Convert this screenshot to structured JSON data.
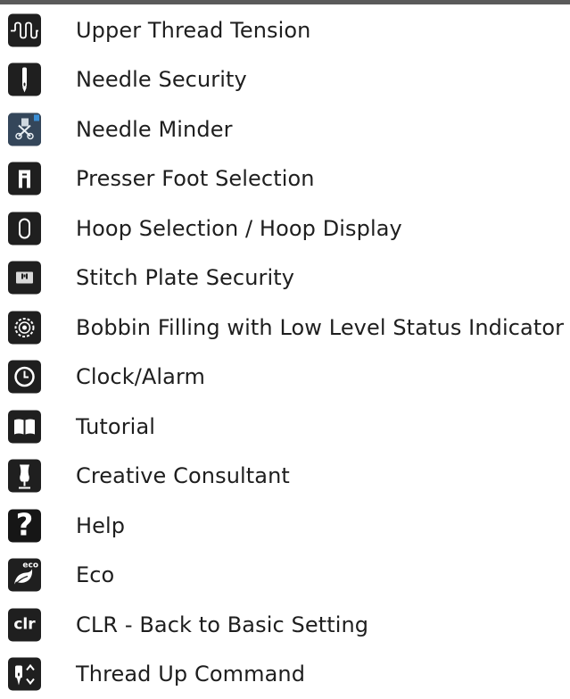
{
  "items": [
    {
      "icon": "thread-tension-icon",
      "label": "Upper Thread Tension"
    },
    {
      "icon": "needle-icon",
      "label": "Needle Security"
    },
    {
      "icon": "needle-minder-icon",
      "label": "Needle Minder"
    },
    {
      "icon": "presser-foot-icon",
      "label": "Presser Foot Selection"
    },
    {
      "icon": "hoop-icon",
      "label": "Hoop Selection / Hoop Display"
    },
    {
      "icon": "stitch-plate-icon",
      "label": "Stitch Plate Security"
    },
    {
      "icon": "bobbin-icon",
      "label": "Bobbin Filling with Low Level Status Indicator"
    },
    {
      "icon": "clock-icon",
      "label": "Clock/Alarm"
    },
    {
      "icon": "book-icon",
      "label": "Tutorial"
    },
    {
      "icon": "dress-form-icon",
      "label": "Creative Consultant"
    },
    {
      "icon": "help-icon",
      "label": "Help",
      "glyph": "?"
    },
    {
      "icon": "eco-leaf-icon",
      "label": "Eco",
      "glyph": "eco"
    },
    {
      "icon": "clr-icon",
      "label": "CLR - Back to Basic Setting",
      "glyph": "clr"
    },
    {
      "icon": "needle-up-down-icon",
      "label": "Thread Up Command"
    }
  ],
  "colors": {
    "icon_bg": "#1f1f1f",
    "text": "#1e1e1e",
    "top_bar": "#5a5a5a"
  }
}
